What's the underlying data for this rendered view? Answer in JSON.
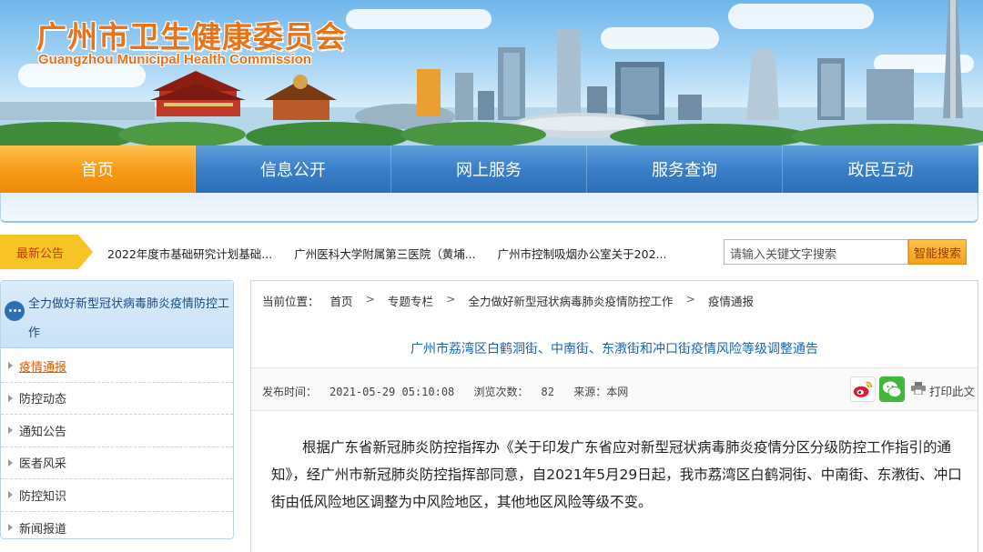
{
  "header": {
    "title": "广州市卫生健康委员会",
    "subtitle": "Guangzhou Municipal Health Commission"
  },
  "nav": {
    "items": [
      "首页",
      "信息公开",
      "网上服务",
      "服务查询",
      "政民互动"
    ],
    "active": "首页"
  },
  "notice": {
    "tag": "最新公告",
    "items": [
      "2022年度市基础研究计划基础...",
      "广州医科大学附属第三医院（黄埔...",
      "广州市控制吸烟办公室关于202..."
    ]
  },
  "search": {
    "placeholder": "请输入关键文字搜索",
    "button": "智能搜索"
  },
  "sidebar": {
    "heading": "全力做好新型冠状病毒肺炎疫情防控工作",
    "items": [
      {
        "label": "疫情通报",
        "active": true
      },
      {
        "label": "防控动态"
      },
      {
        "label": "通知公告"
      },
      {
        "label": "医者风采"
      },
      {
        "label": "防控知识"
      },
      {
        "label": "新闻报道"
      }
    ]
  },
  "breadcrumb": {
    "prefix": "当前位置：",
    "items": [
      "首页",
      "专题专栏",
      "全力做好新型冠状病毒肺炎疫情防控工作",
      "疫情通报"
    ]
  },
  "article": {
    "title": "广州市荔湾区白鹤洞街、中南街、东漖街和冲口街疫情风险等级调整通告",
    "published_label": "发布时间：",
    "published": "2021-05-29 05:10:08",
    "views_label": "浏览次数：",
    "views": "82",
    "source_label": "来源：",
    "source": "本网",
    "print_label": "打印此文",
    "body": "根据广东省新冠肺炎防控指挥办《关于印发广东省应对新型冠状病毒肺炎疫情分区分级防控工作指引的通知》，经广州市新冠肺炎防控指挥部同意，自2021年5月29日起，我市荔湾区白鹤洞街、中南街、东漖街、冲口街由低风险地区调整为中风险地区，其他地区风险等级不变。"
  },
  "colors": {
    "nav_blue": "#3a7fc8",
    "nav_active_orange": "#f59a16",
    "title_orange": "#e8731a",
    "link_blue": "#1d63b5",
    "active_link": "#e05a00"
  }
}
